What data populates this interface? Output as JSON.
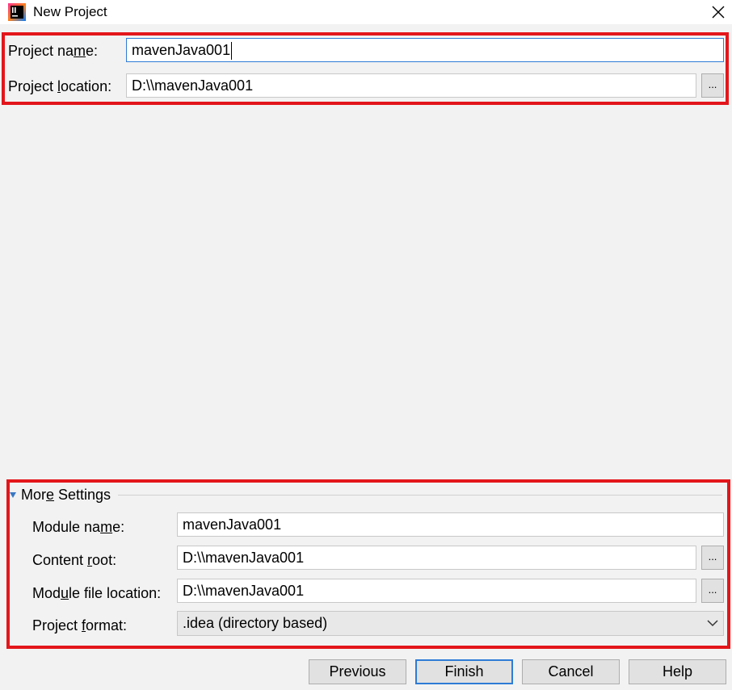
{
  "window": {
    "title": "New Project",
    "app_icon": "intellij-idea-icon",
    "close_icon": "close-icon"
  },
  "project": {
    "name_label": "Project name:",
    "name_value": "mavenJava001",
    "location_label": "Project location:",
    "location_value": "D:\\\\mavenJava001",
    "browse_label": "..."
  },
  "more_settings": {
    "header": "More Settings",
    "module_name_label": "Module name:",
    "module_name_value": "mavenJava001",
    "content_root_label": "Content root:",
    "content_root_value": "D:\\\\mavenJava001",
    "module_file_location_label": "Module file location:",
    "module_file_location_value": "D:\\\\mavenJava001",
    "project_format_label": "Project format:",
    "project_format_value": ".idea (directory based)",
    "browse_label": "..."
  },
  "buttons": {
    "previous": "Previous",
    "finish": "Finish",
    "cancel": "Cancel",
    "help": "Help"
  },
  "colors": {
    "highlight": "#e3161b",
    "focus": "#2e7bd6",
    "background": "#f2f2f2"
  }
}
